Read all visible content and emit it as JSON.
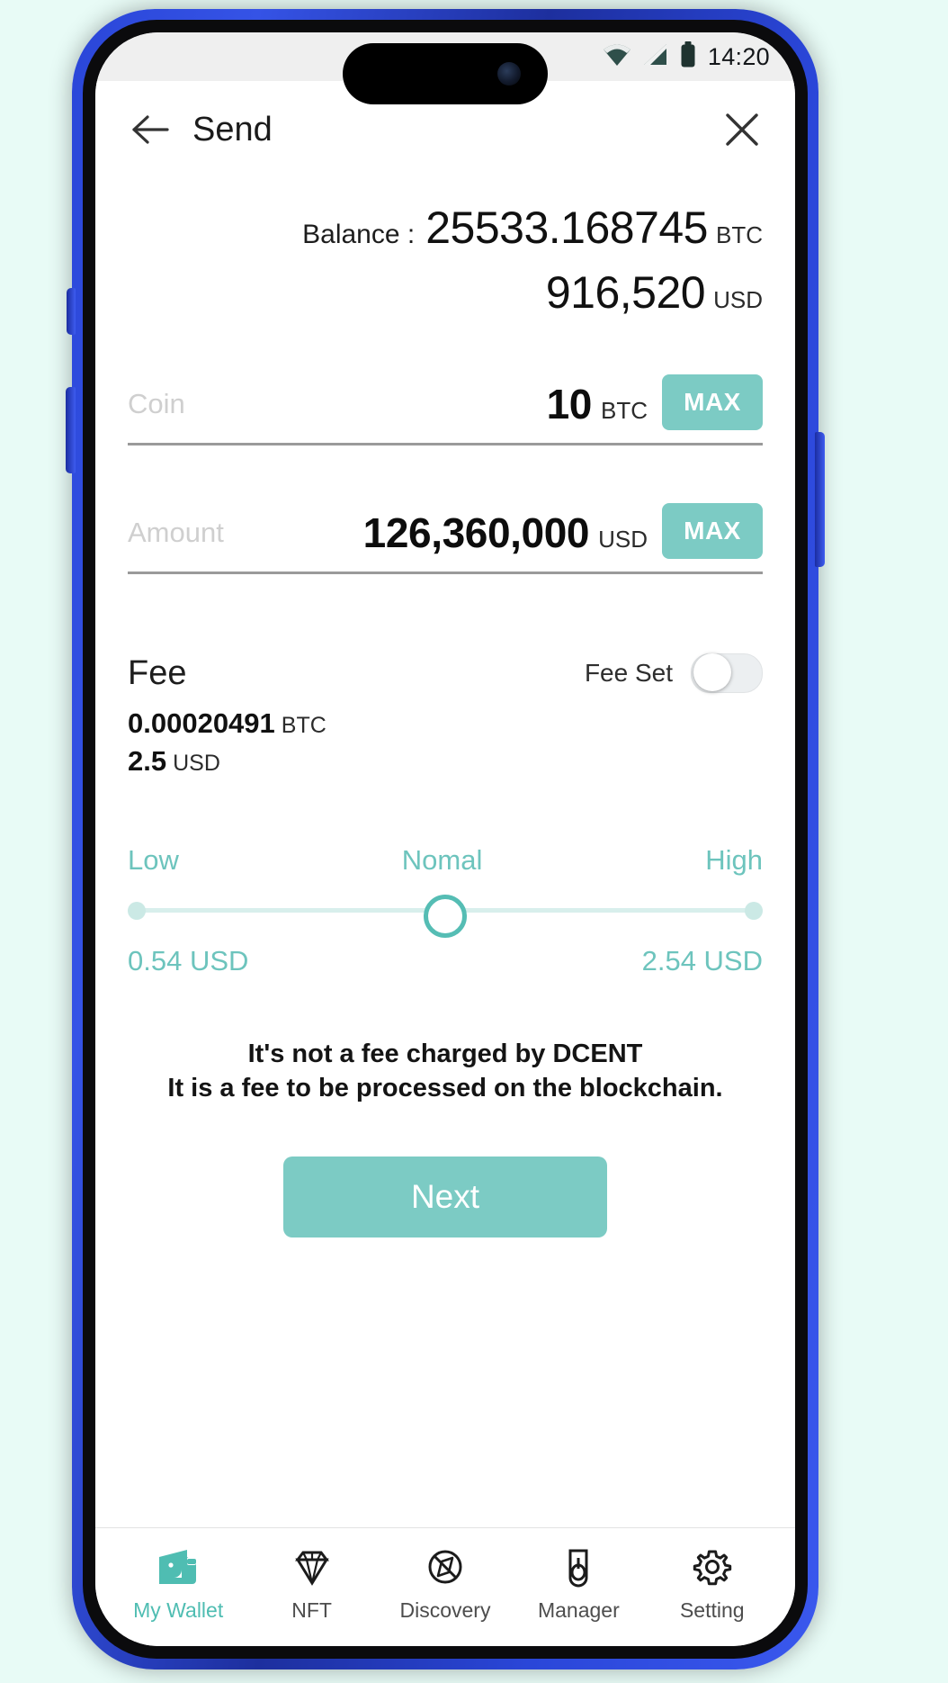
{
  "status_bar": {
    "time": "14:20",
    "icons": [
      "wifi-icon",
      "cellular-signal-icon",
      "battery-icon"
    ]
  },
  "header": {
    "back_icon": "back-arrow-icon",
    "title": "Send",
    "close_icon": "close-x-icon"
  },
  "balance": {
    "label": "Balance :",
    "btc_value": "25533.168745",
    "btc_unit": "BTC",
    "usd_value": "916,520",
    "usd_unit": "USD"
  },
  "form": {
    "coin": {
      "placeholder": "Coin",
      "value": "10",
      "unit": "BTC",
      "max_label": "MAX"
    },
    "amount": {
      "placeholder": "Amount",
      "value": "126,360,000",
      "unit": "USD",
      "max_label": "MAX"
    }
  },
  "fee": {
    "title": "Fee",
    "fee_set_label": "Fee Set",
    "fee_set_on": false,
    "btc_value": "0.00020491",
    "btc_unit": "BTC",
    "usd_value": "2.5",
    "usd_unit": "USD"
  },
  "slider": {
    "low_label": "Low",
    "normal_label": "Nomal",
    "high_label": "High",
    "low_value": "0.54 USD",
    "high_value": "2.54 USD",
    "position_percent": 50
  },
  "disclaimer": {
    "line1": "It's not a fee charged by DCENT",
    "line2": "It is a fee to be processed on the blockchain."
  },
  "next_button": {
    "label": "Next"
  },
  "bottom_nav": {
    "items": [
      {
        "label": "My Wallet",
        "icon": "wallet-icon",
        "active": true
      },
      {
        "label": "NFT",
        "icon": "diamond-icon",
        "active": false
      },
      {
        "label": "Discovery",
        "icon": "compass-icon",
        "active": false
      },
      {
        "label": "Manager",
        "icon": "device-icon",
        "active": false
      },
      {
        "label": "Setting",
        "icon": "gear-icon",
        "active": false
      }
    ]
  },
  "colors": {
    "accent": "#7ccbc4",
    "accent_text": "#6dc4bd",
    "frame": "#2a46d8"
  }
}
